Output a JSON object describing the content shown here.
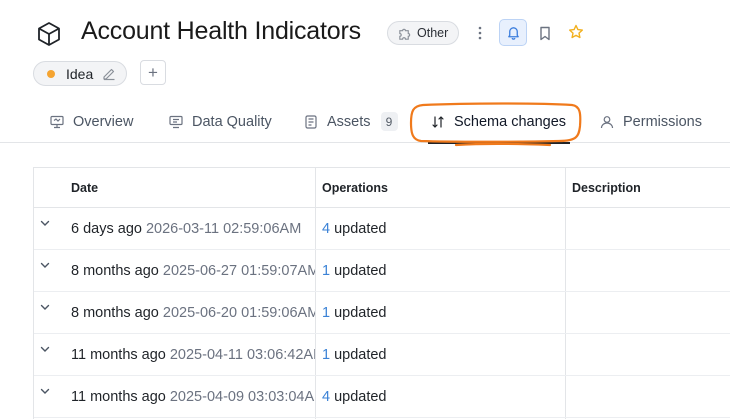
{
  "header": {
    "title": "Account Health Indicators",
    "type_badge": "Other",
    "icons": [
      "cube-icon",
      "kebab-icon",
      "bell-icon",
      "bookmark-icon",
      "star-icon"
    ],
    "colors": {
      "star": "#f2b01e",
      "bell_bg": "#e8f0fd",
      "bell_fg": "#3b7ddd"
    }
  },
  "status": {
    "label": "Idea",
    "dot_color": "#f5a431"
  },
  "tabs": [
    {
      "label": "Overview",
      "icon": "dashboard-icon"
    },
    {
      "label": "Data Quality",
      "icon": "data-quality-icon"
    },
    {
      "label": "Assets",
      "icon": "assets-icon",
      "count": "9"
    },
    {
      "label": "Schema changes",
      "icon": "sort-arrows-icon",
      "active": true
    },
    {
      "label": "Permissions",
      "icon": "user-icon"
    }
  ],
  "annotation_color": "#f07a1c",
  "table": {
    "columns": [
      "Date",
      "Operations",
      "Description"
    ],
    "rows": [
      {
        "relative": "6 days ago",
        "absolute": "2026-03-11 02:59:06AM",
        "ops_count": "4",
        "ops_label": "updated",
        "description": ""
      },
      {
        "relative": "8 months ago",
        "absolute": "2025-06-27 01:59:07AM",
        "ops_count": "1",
        "ops_label": "updated",
        "description": ""
      },
      {
        "relative": "8 months ago",
        "absolute": "2025-06-20 01:59:06AM",
        "ops_count": "1",
        "ops_label": "updated",
        "description": ""
      },
      {
        "relative": "11 months ago",
        "absolute": "2025-04-11 03:06:42AM",
        "ops_count": "1",
        "ops_label": "updated",
        "description": ""
      },
      {
        "relative": "11 months ago",
        "absolute": "2025-04-09 03:03:04AM",
        "ops_count": "4",
        "ops_label": "updated",
        "description": ""
      }
    ],
    "accent": "#3b82d6"
  }
}
